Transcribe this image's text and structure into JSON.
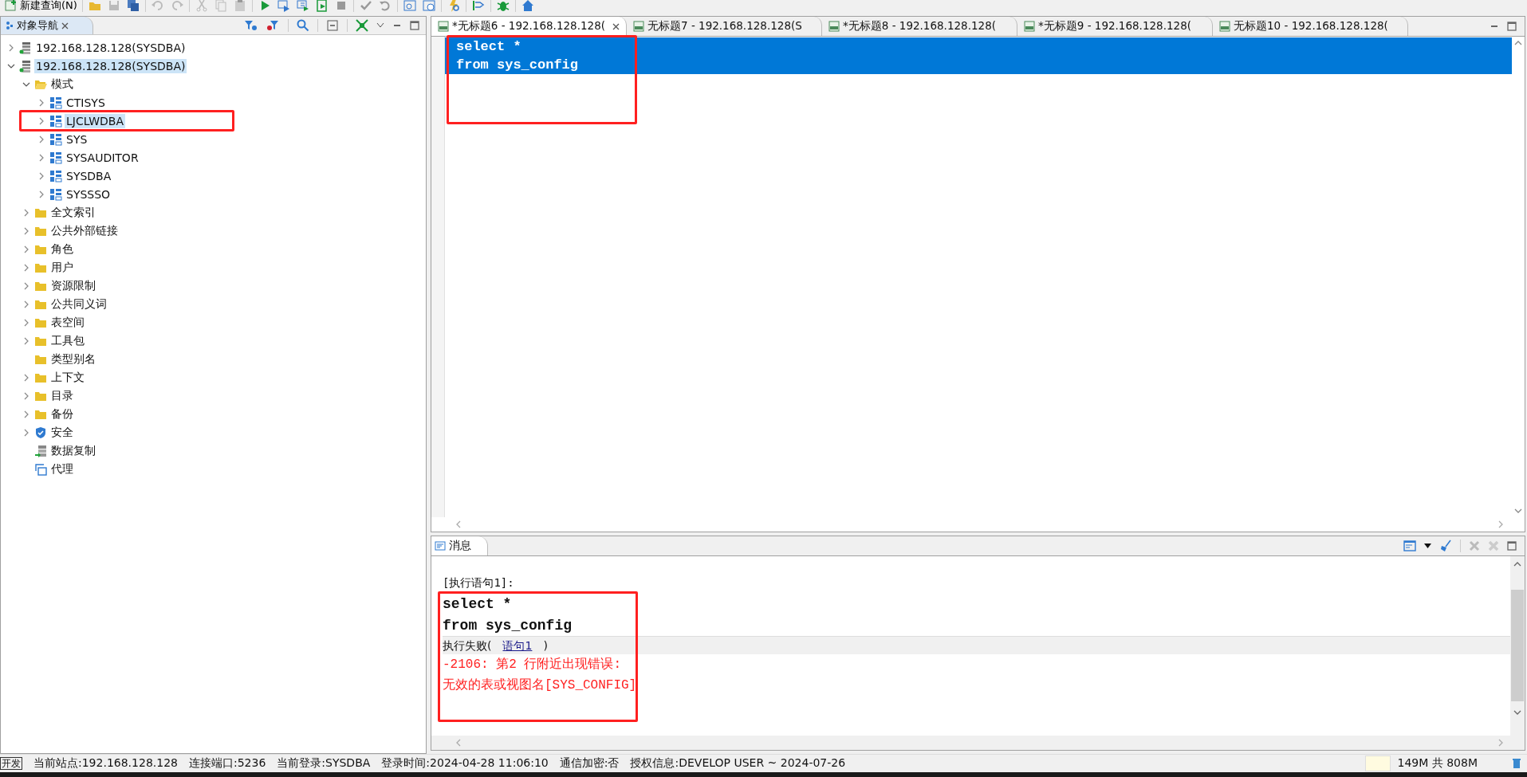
{
  "toolbar": {
    "new_query": "新建查询(N)"
  },
  "navigator": {
    "title": "对象导航",
    "tree": [
      {
        "label": "192.168.128.128(SYSDBA)",
        "kind": "server",
        "expanded": false,
        "selected": false
      },
      {
        "label": "192.168.128.128(SYSDBA)",
        "kind": "server",
        "expanded": true,
        "selected": true,
        "children": [
          {
            "label": "模式",
            "kind": "folder-open",
            "expanded": true,
            "selected": false,
            "children": [
              {
                "label": "CTISYS",
                "kind": "schema",
                "expanded": false,
                "selected": false
              },
              {
                "label": "LJCLWDBA",
                "kind": "schema",
                "expanded": false,
                "selected": true
              },
              {
                "label": "SYS",
                "kind": "schema",
                "expanded": false,
                "selected": false
              },
              {
                "label": "SYSAUDITOR",
                "kind": "schema",
                "expanded": false,
                "selected": false
              },
              {
                "label": "SYSDBA",
                "kind": "schema",
                "expanded": false,
                "selected": false
              },
              {
                "label": "SYSSSO",
                "kind": "schema",
                "expanded": false,
                "selected": false
              }
            ]
          },
          {
            "label": "全文索引",
            "kind": "folder",
            "expanded": false,
            "selected": false
          },
          {
            "label": "公共外部链接",
            "kind": "folder",
            "expanded": false,
            "selected": false
          },
          {
            "label": "角色",
            "kind": "folder",
            "expanded": false,
            "selected": false
          },
          {
            "label": "用户",
            "kind": "folder",
            "expanded": false,
            "selected": false
          },
          {
            "label": "资源限制",
            "kind": "folder",
            "expanded": false,
            "selected": false
          },
          {
            "label": "公共同义词",
            "kind": "folder",
            "expanded": false,
            "selected": false
          },
          {
            "label": "表空间",
            "kind": "folder",
            "expanded": false,
            "selected": false
          },
          {
            "label": "工具包",
            "kind": "folder",
            "expanded": false,
            "selected": false
          },
          {
            "label": "类型别名",
            "kind": "folder",
            "selected": false
          },
          {
            "label": "上下文",
            "kind": "folder",
            "expanded": false,
            "selected": false
          },
          {
            "label": "目录",
            "kind": "folder",
            "expanded": false,
            "selected": false
          },
          {
            "label": "备份",
            "kind": "folder",
            "expanded": false,
            "selected": false
          },
          {
            "label": "安全",
            "kind": "shield",
            "expanded": false,
            "selected": false
          },
          {
            "label": "数据复制",
            "kind": "replication",
            "selected": false
          },
          {
            "label": "代理",
            "kind": "agent",
            "selected": false
          }
        ]
      }
    ]
  },
  "editor": {
    "tabs": [
      {
        "label": "*无标题6 - 192.168.128.128(",
        "selected": true
      },
      {
        "label": "无标题7 - 192.168.128.128(S",
        "selected": false
      },
      {
        "label": "*无标题8 - 192.168.128.128(",
        "selected": false
      },
      {
        "label": "*无标题9 - 192.168.128.128(",
        "selected": false
      },
      {
        "label": "无标题10 - 192.168.128.128(",
        "selected": false
      }
    ],
    "lines": [
      {
        "text": "select *",
        "selected": true
      },
      {
        "text": "from sys_config",
        "selected": true
      }
    ]
  },
  "messages": {
    "title": "消息",
    "lines": [
      {
        "kind": "plain",
        "text": "[执行语句1]:"
      },
      {
        "kind": "code",
        "text": "select *"
      },
      {
        "kind": "code",
        "text": "from sys_config"
      },
      {
        "kind": "status",
        "text": "执行失败(",
        "link": "语句1",
        "after": ")"
      },
      {
        "kind": "error",
        "text": "-2106: 第2 行附近出现错误:"
      },
      {
        "kind": "error",
        "text": "无效的表或视图名[SYS_CONFIG]"
      }
    ]
  },
  "status_bar": {
    "mode": "开发",
    "items": [
      "当前站点:192.168.128.128",
      "连接端口:5236",
      "当前登录:SYSDBA",
      "登录时间:2024-04-28 11:06:10",
      "通信加密:否",
      "授权信息:DEVELOP USER ~ 2024-07-26"
    ],
    "memory": "149M 共 808M"
  }
}
